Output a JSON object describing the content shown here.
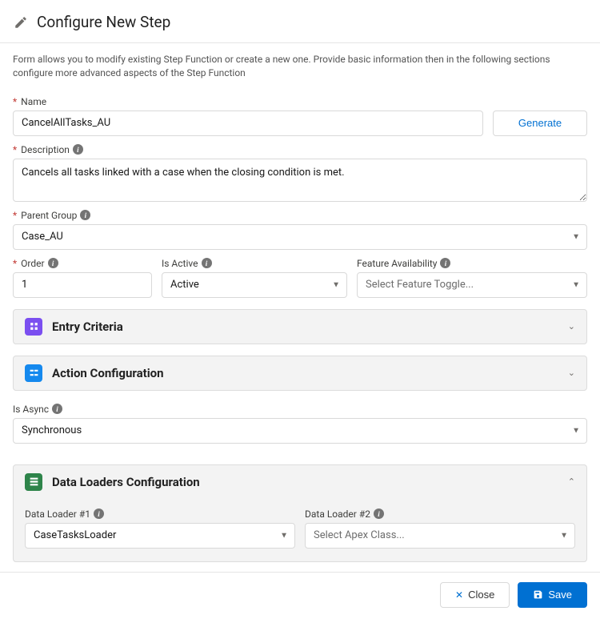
{
  "header": {
    "title": "Configure New Step"
  },
  "intro": "Form allows you to modify existing Step Function or create a new one. Provide basic information then in the following sections configure more advanced aspects of the Step Function",
  "fields": {
    "name": {
      "label": "Name",
      "value": "CancelAllTasks_AU"
    },
    "generate": {
      "label": "Generate"
    },
    "description": {
      "label": "Description",
      "value": "Cancels all tasks linked with a case when the closing condition is met."
    },
    "parentGroup": {
      "label": "Parent Group",
      "value": "Case_AU"
    },
    "order": {
      "label": "Order",
      "value": "1"
    },
    "isActive": {
      "label": "Is Active",
      "value": "Active"
    },
    "featureAvailability": {
      "label": "Feature Availability",
      "placeholder": "Select Feature Toggle..."
    },
    "isAsync": {
      "label": "Is Async",
      "value": "Synchronous"
    }
  },
  "panels": {
    "entryCriteria": {
      "title": "Entry Criteria"
    },
    "actionConfig": {
      "title": "Action Configuration"
    },
    "dataLoaders": {
      "title": "Data Loaders Configuration",
      "loader1": {
        "label": "Data Loader #1",
        "value": "CaseTasksLoader"
      },
      "loader2": {
        "label": "Data Loader #2",
        "placeholder": "Select Apex Class..."
      }
    }
  },
  "footer": {
    "close": "Close",
    "save": "Save"
  }
}
